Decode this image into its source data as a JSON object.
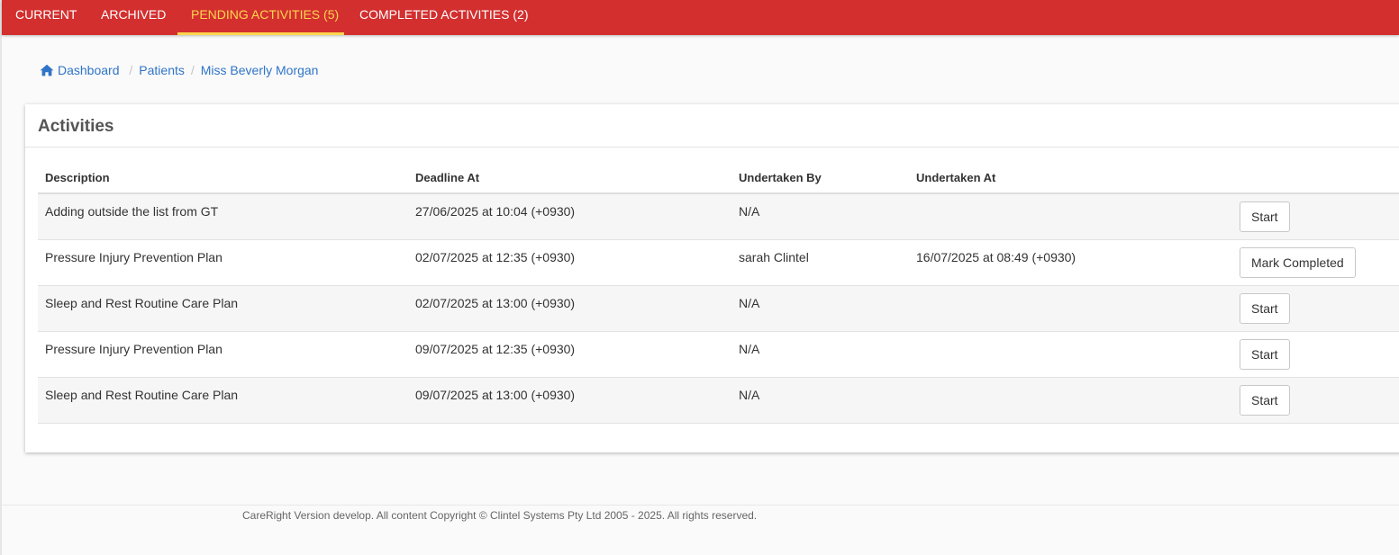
{
  "nav": {
    "tabs": [
      {
        "label": "CURRENT",
        "active": false
      },
      {
        "label": "ARCHIVED",
        "active": false
      },
      {
        "label": "PENDING ACTIVITIES (5)",
        "active": true
      },
      {
        "label": "COMPLETED ACTIVITIES (2)",
        "active": false
      }
    ],
    "background_color": "#d32f2f",
    "active_color": "#ffd54f"
  },
  "breadcrumb": {
    "icon": "home-icon",
    "items": [
      "Dashboard",
      "Patients",
      "Miss Beverly Morgan"
    ]
  },
  "activities": {
    "title": "Activities",
    "columns": [
      "Description",
      "Deadline At",
      "Undertaken By",
      "Undertaken At"
    ],
    "rows": [
      {
        "description": "Adding outside the list from GT",
        "deadline_at": "27/06/2025 at 10:04 (+0930)",
        "undertaken_by": "N/A",
        "undertaken_at": "",
        "action": "Start"
      },
      {
        "description": "Pressure Injury Prevention Plan",
        "deadline_at": "02/07/2025 at 12:35 (+0930)",
        "undertaken_by": "sarah Clintel",
        "undertaken_at": "16/07/2025 at 08:49 (+0930)",
        "action": "Mark Completed"
      },
      {
        "description": "Sleep and Rest Routine Care Plan",
        "deadline_at": "02/07/2025 at 13:00 (+0930)",
        "undertaken_by": "N/A",
        "undertaken_at": "",
        "action": "Start"
      },
      {
        "description": "Pressure Injury Prevention Plan",
        "deadline_at": "09/07/2025 at 12:35 (+0930)",
        "undertaken_by": "N/A",
        "undertaken_at": "",
        "action": "Start"
      },
      {
        "description": "Sleep and Rest Routine Care Plan",
        "deadline_at": "09/07/2025 at 13:00 (+0930)",
        "undertaken_by": "N/A",
        "undertaken_at": "",
        "action": "Start"
      }
    ]
  },
  "footer": {
    "text": "CareRight Version develop. All content Copyright © Clintel Systems Pty Ltd 2005 - 2025. All rights reserved."
  }
}
